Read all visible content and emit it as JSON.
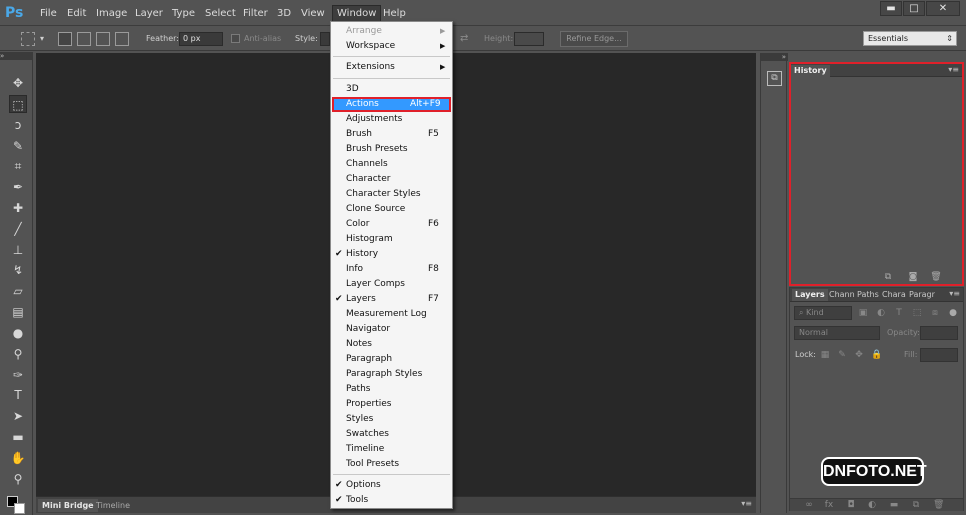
{
  "menubar": {
    "logo": "Ps",
    "items": [
      "File",
      "Edit",
      "Image",
      "Layer",
      "Type",
      "Select",
      "Filter",
      "3D",
      "View",
      "Window",
      "Help"
    ],
    "active_item": "Window"
  },
  "window_controls": {
    "minimize": "▬",
    "maximize": "□",
    "close": "✕"
  },
  "options": {
    "feather_label": "Feather:",
    "feather_value": "0 px",
    "antialias_label": "Anti-alias",
    "style_label": "Style:",
    "height_label": "Height:",
    "refine_edge": "Refine Edge...",
    "workspace": "Essentials"
  },
  "window_menu": {
    "items": [
      {
        "label": "Arrange",
        "submenu": true,
        "disabled": true
      },
      {
        "label": "Workspace",
        "submenu": true
      },
      {
        "label": "Extensions",
        "submenu": true
      },
      {
        "label": "3D"
      },
      {
        "label": "Actions",
        "shortcut": "Alt+F9",
        "highlighted": true
      },
      {
        "label": "Adjustments"
      },
      {
        "label": "Brush",
        "shortcut": "F5"
      },
      {
        "label": "Brush Presets"
      },
      {
        "label": "Channels"
      },
      {
        "label": "Character"
      },
      {
        "label": "Character Styles"
      },
      {
        "label": "Clone Source"
      },
      {
        "label": "Color",
        "shortcut": "F6"
      },
      {
        "label": "Histogram"
      },
      {
        "label": "History",
        "checked": true
      },
      {
        "label": "Info",
        "shortcut": "F8"
      },
      {
        "label": "Layer Comps"
      },
      {
        "label": "Layers",
        "shortcut": "F7",
        "checked": true
      },
      {
        "label": "Measurement Log"
      },
      {
        "label": "Navigator"
      },
      {
        "label": "Notes"
      },
      {
        "label": "Paragraph"
      },
      {
        "label": "Paragraph Styles"
      },
      {
        "label": "Paths"
      },
      {
        "label": "Properties"
      },
      {
        "label": "Styles"
      },
      {
        "label": "Swatches"
      },
      {
        "label": "Timeline"
      },
      {
        "label": "Tool Presets"
      },
      {
        "label": "Options",
        "checked": true
      },
      {
        "label": "Tools",
        "checked": true
      }
    ]
  },
  "history_panel": {
    "tab": "History"
  },
  "layers_panel": {
    "tabs": [
      "Layers",
      "Chann",
      "Paths",
      "Chara",
      "Paragr"
    ],
    "kind_label": "Kind",
    "blend_mode": "Normal",
    "opacity_label": "Opacity:",
    "lock_label": "Lock:",
    "fill_label": "Fill:"
  },
  "bottom_tabs": [
    "Mini Bridge",
    "Timeline"
  ],
  "watermark": "DNFOTO.NET",
  "colors": {
    "accent": "#3399ff",
    "highlight_border": "#e0202a"
  }
}
